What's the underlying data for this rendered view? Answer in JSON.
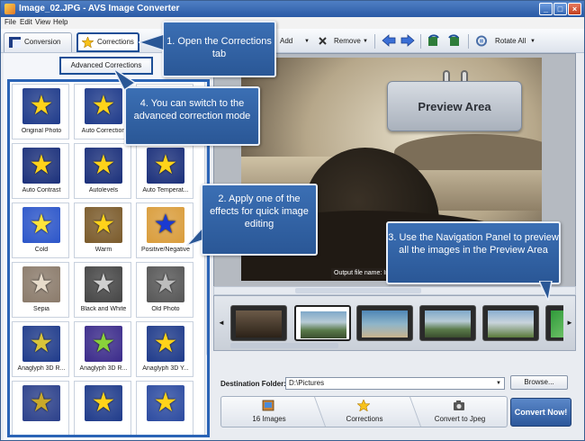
{
  "window": {
    "title": "Image_02.JPG - AVS Image Converter",
    "minimize": "_",
    "maximize": "□",
    "close": "×"
  },
  "menu": {
    "file": "File",
    "edit": "Edit",
    "view": "View",
    "help": "Help"
  },
  "toolbar": {
    "tab_conversion": "Conversion",
    "tab_corrections": "Corrections",
    "add": "Add",
    "remove": "Remove",
    "rotate_all": "Rotate All",
    "dropdown_glyph": "▼"
  },
  "left_panel": {
    "advanced_button": "Advanced Corrections",
    "effects": [
      {
        "label": "Original Photo",
        "bg": "#1e3a8a",
        "star": "#ffd31a"
      },
      {
        "label": "Auto Correction",
        "bg": "#1e3a8a",
        "star": "#ffd31a"
      },
      {
        "label": "",
        "bg": "#1e3a8a",
        "star": "#ffd31a"
      },
      {
        "label": "Auto Contrast",
        "bg": "#1a2f7a",
        "star": "#ffd31a"
      },
      {
        "label": "Autolevels",
        "bg": "#1a2f7a",
        "star": "#ffd31a"
      },
      {
        "label": "Auto Temperat...",
        "bg": "#1a2f7a",
        "star": "#ffd31a"
      },
      {
        "label": "Cold",
        "bg": "#2b55c9",
        "star": "#ffe43a"
      },
      {
        "label": "Warm",
        "bg": "#7a5a2a",
        "star": "#ffd31a"
      },
      {
        "label": "Positive/Negative",
        "bg": "#d99c3a",
        "star": "#1a3ad1"
      },
      {
        "label": "Sepia",
        "bg": "#8a7a6a",
        "star": "#e8dccb"
      },
      {
        "label": "Black and White",
        "bg": "#444444",
        "star": "#cfcfcf"
      },
      {
        "label": "Old Photo",
        "bg": "#555555",
        "star": "#bdbdbd"
      },
      {
        "label": "Anaglyph 3D R...",
        "bg": "#1e3a8a",
        "star": "#d9c43a"
      },
      {
        "label": "Anaglyph 3D R...",
        "bg": "#3a2a8a",
        "star": "#8ad13a"
      },
      {
        "label": "Anaglyph 3D Y...",
        "bg": "#1e3a8a",
        "star": "#ffd31a"
      },
      {
        "label": "",
        "bg": "#2a3f8a",
        "star": "#c9a92a"
      },
      {
        "label": "",
        "bg": "#1e3a8a",
        "star": "#ffd31a"
      },
      {
        "label": "",
        "bg": "#2b4aa0",
        "star": "#ffd31a"
      }
    ]
  },
  "preview": {
    "area_label": "Preview Area",
    "output_name": "Output file name: Image_02..."
  },
  "nav_panel": {
    "left_arrow": "◄",
    "right_arrow": "►"
  },
  "bottom": {
    "destination_label": "Destination Folder:",
    "destination_value": "D:\\Pictures",
    "browse": "Browse...",
    "step_images": "16 Images",
    "step_corrections": "Corrections",
    "step_convert": "Convert to Jpeg",
    "convert_now": "Convert Now!"
  },
  "callouts": {
    "c1": "1. Open the Corrections tab",
    "c2": "2. Apply one of the effects for quick image editing",
    "c3": "3. Use the Navigation Panel to preview all the images in the Preview Area",
    "c4": "4. You can switch to the advanced correction mode"
  }
}
